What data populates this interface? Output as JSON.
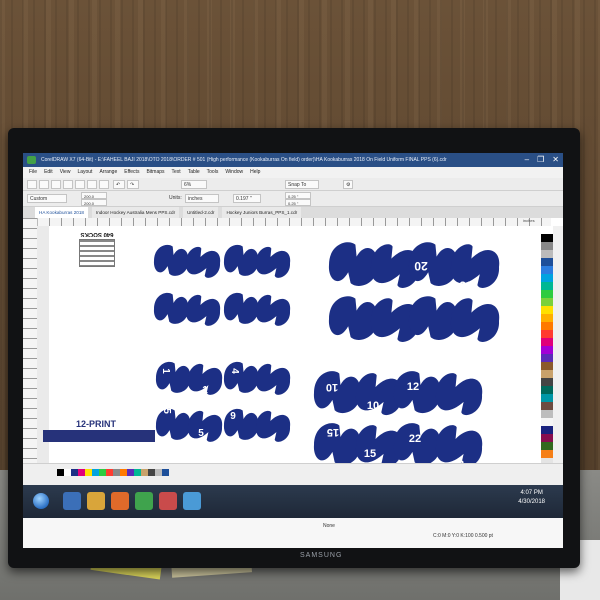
{
  "app": {
    "title": "CorelDRAW X7 (64-Bit) - E:\\FAHEEL BAJI 2018\\OTO 2018\\ORDER # 501 (High performance (Kookaburras On field) order)\\HA Kookaburras 2018 On Field Uniform FINAL PPS (6).cdr",
    "menu": [
      "File",
      "Edit",
      "View",
      "Layout",
      "Arrange",
      "Effects",
      "Bitmaps",
      "Text",
      "Table",
      "Tools",
      "Window",
      "Help"
    ],
    "toolbar": {
      "preset": "Custom",
      "width": "200.0",
      "height": "200.0",
      "units_label": "Units:",
      "units_value": "inches",
      "nudge": "0.197 \"",
      "dup_x": "0.25 \"",
      "dup_y": "0.25 \"",
      "zoom": "6%",
      "snap_to": "Snap To"
    },
    "tabs": [
      {
        "label": "HA Kookaburras 2018",
        "active": true
      },
      {
        "label": "Indoor Hockey Australia Mens PPS.cdr",
        "active": false
      },
      {
        "label": "Untitled-2.cdr",
        "active": false
      },
      {
        "label": "Hockey Juniors Burras_PPS_1.cdr",
        "active": false
      }
    ],
    "ruler_unit": "inches"
  },
  "canvas": {
    "sheet_title": "640 SOCKS",
    "print_label": "12-PRINT",
    "panels": [
      {
        "group": "top-left",
        "numbers": []
      },
      {
        "group": "top-right",
        "numbers": [
          "20",
          "20"
        ]
      },
      {
        "group": "bottom-left",
        "numbers": [
          "1",
          "1",
          "4",
          "4",
          "5",
          "5",
          "9",
          "6"
        ]
      },
      {
        "group": "bottom-right",
        "numbers": [
          "10",
          "10",
          "12",
          "12",
          "15",
          "15",
          "22",
          "22"
        ]
      }
    ],
    "panel_color": "#1c2f85"
  },
  "status": {
    "cmyk": "C:0 M:0 Y:0 K:100  0.500 pt",
    "note": "None"
  },
  "taskbar": {
    "time": "4:07 PM",
    "date": "4/30/2018"
  },
  "monitor": {
    "brand": "SAMSUNG"
  }
}
